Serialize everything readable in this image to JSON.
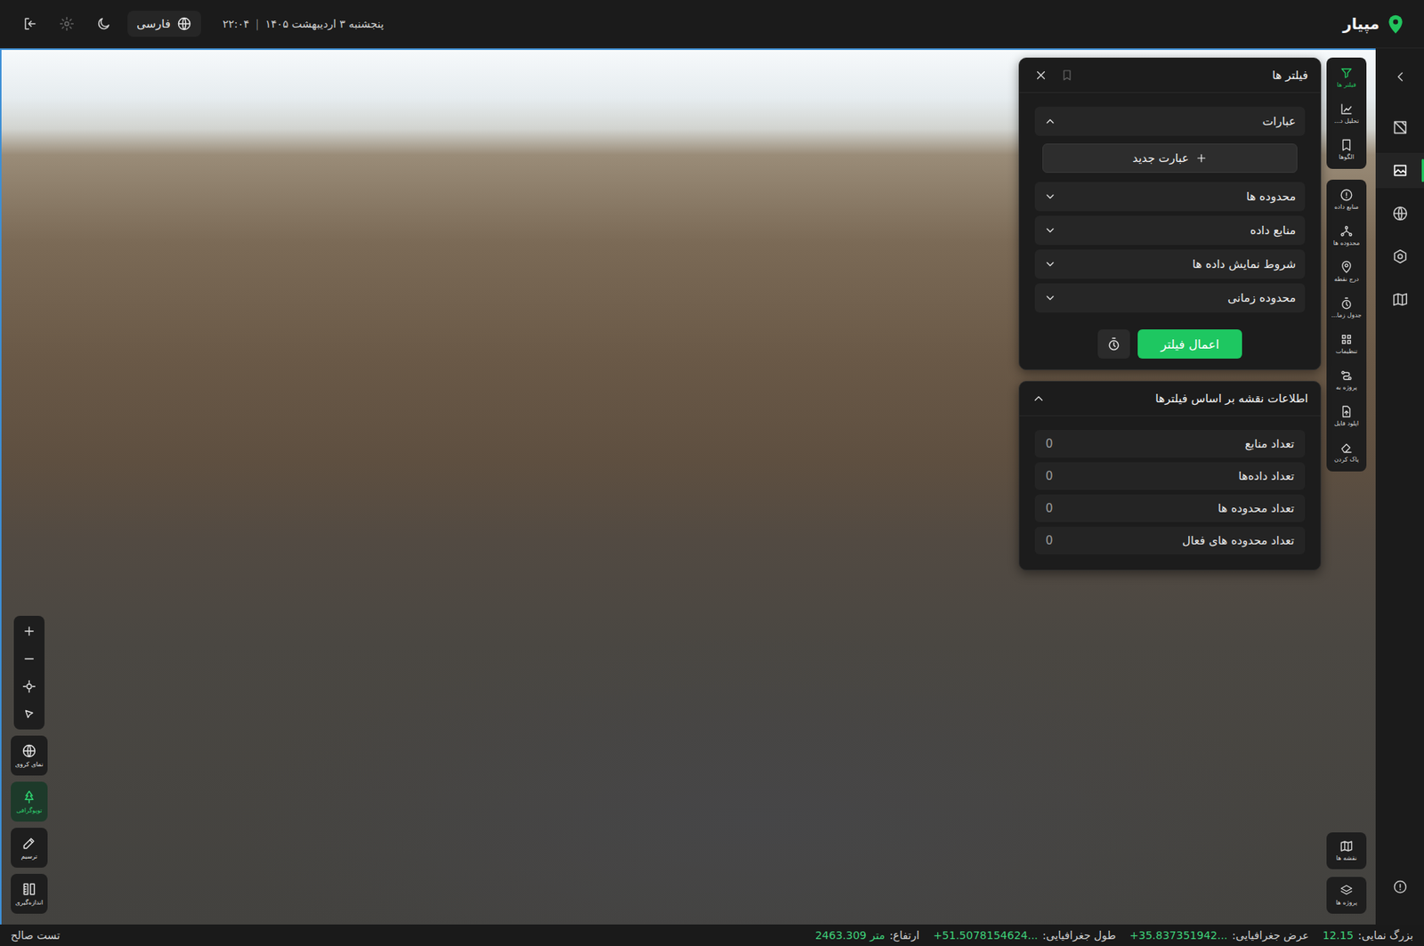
{
  "header": {
    "logo": "مپیار",
    "date": "پنجشنبه ۳ اردیبهشت ۱۴۰۵",
    "separator": "|",
    "time": "۲۲:۰۴",
    "language": "فارسی"
  },
  "rail": {
    "items": [
      {
        "selected": false
      },
      {
        "selected": true
      },
      {
        "selected": false
      },
      {
        "selected": false
      },
      {
        "selected": false
      }
    ]
  },
  "tools": {
    "primary": [
      {
        "label": "فیلتر ها",
        "selected": true
      },
      {
        "label": "تحلیل د...",
        "selected": false
      },
      {
        "label": "الگوها",
        "selected": false
      }
    ],
    "secondary": [
      {
        "label": "منابع داده",
        "selected": false
      },
      {
        "label": "محدوده ها",
        "selected": false
      },
      {
        "label": "درج نقطه",
        "selected": false
      },
      {
        "label": "جدول زما...",
        "selected": false
      },
      {
        "label": "تنظیمات",
        "selected": false
      },
      {
        "label": "پروژه به",
        "selected": false
      },
      {
        "label": "اپلود فایل",
        "selected": false
      },
      {
        "label": "پاک کردن",
        "selected": false
      }
    ],
    "bottom": [
      {
        "label": "نقشه ها",
        "selected": false
      },
      {
        "label": "پروژه ها",
        "selected": false
      }
    ]
  },
  "map_controls": {
    "layers": [
      {
        "label": "نمای کروی",
        "selected": false
      },
      {
        "label": "توپوگرافی",
        "selected": true
      },
      {
        "label": "ترسیم",
        "selected": false
      },
      {
        "label": "اندازه‌گیری",
        "selected": false
      }
    ]
  },
  "filters": {
    "title": "فیلتر ها",
    "sections": [
      {
        "label": "عبارات",
        "expanded": true,
        "action": "عبارت جدید"
      },
      {
        "label": "محدوده ها",
        "expanded": false
      },
      {
        "label": "منابع داده",
        "expanded": false
      },
      {
        "label": "شروط نمایش داده ها",
        "expanded": false
      },
      {
        "label": "محدوده زمانی",
        "expanded": false
      }
    ],
    "apply": "اعمال فیلتر"
  },
  "map_info": {
    "title": "اطلاعات نقشه بر اساس فیلترها",
    "expanded": true,
    "rows": [
      {
        "label": "تعداد منابع",
        "value": "0"
      },
      {
        "label": "تعداد داده‌ها",
        "value": "0"
      },
      {
        "label": "تعداد محدوده ها",
        "value": "0"
      },
      {
        "label": "تعداد محدوده های فعال",
        "value": "0"
      }
    ]
  },
  "status_bar": {
    "items": [
      {
        "label": "بزرگ نمایی:",
        "value": "12.15"
      },
      {
        "label": "عرض جغرافیایی:",
        "value": "+35.837351942..."
      },
      {
        "label": "طول جغرافیایی:",
        "value": "+51.5078154624..."
      },
      {
        "label": "ارتفاع:",
        "value": "2463.309 متر"
      }
    ],
    "user": "تست صالح"
  }
}
